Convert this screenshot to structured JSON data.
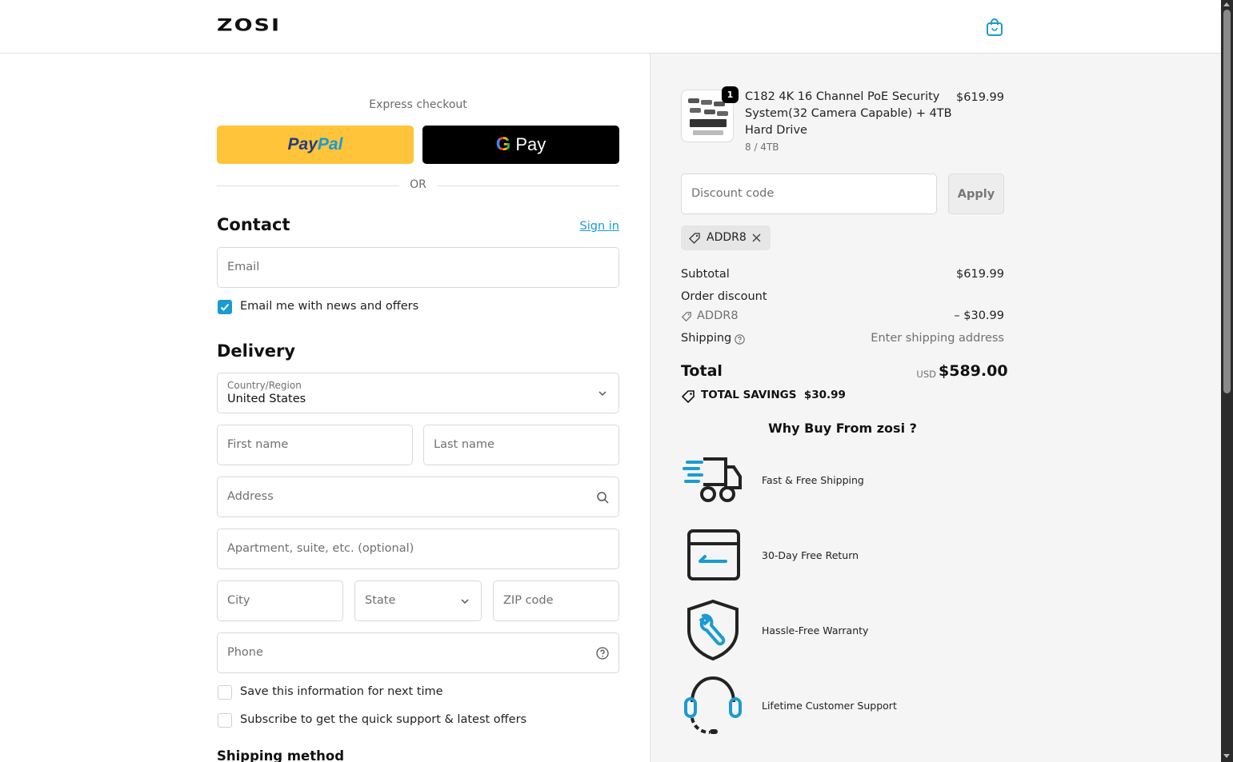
{
  "header": {
    "logo": "ZOSI",
    "cart_icon": "shopping-bag-icon"
  },
  "express": {
    "label": "Express checkout",
    "paypal_part1": "Pay",
    "paypal_part2": "Pal",
    "gpay_g": "G",
    "gpay_text": "Pay",
    "or_text": "OR"
  },
  "contact": {
    "title": "Contact",
    "signin_label": "Sign in",
    "email_placeholder": "Email",
    "news_checkbox_label": "Email me with news and offers",
    "news_checked": true
  },
  "delivery": {
    "title": "Delivery",
    "country_label": "Country/Region",
    "country_value": "United States",
    "first_name_placeholder": "First name",
    "last_name_placeholder": "Last name",
    "address_placeholder": "Address",
    "apartment_placeholder": "Apartment, suite, etc. (optional)",
    "city_placeholder": "City",
    "state_placeholder": "State",
    "zip_placeholder": "ZIP code",
    "phone_placeholder": "Phone",
    "save_info_label": "Save this information for next time",
    "subscribe_label": "Subscribe to get the quick support & latest offers",
    "shipping_method_title": "Shipping method"
  },
  "summary": {
    "product": {
      "quantity": "1",
      "name": "C182 4K 16 Channel PoE Security System(32 Camera Capable) + 4TB Hard Drive",
      "variant": "8 / 4TB",
      "price": "$619.99"
    },
    "discount_placeholder": "Discount code",
    "apply_label": "Apply",
    "applied_code": "ADDR8",
    "subtotal_label": "Subtotal",
    "subtotal_value": "$619.99",
    "order_discount_label": "Order discount",
    "discount_code": "ADDR8",
    "discount_value": "– $30.99",
    "shipping_label": "Shipping",
    "shipping_value": "Enter shipping address",
    "total_label": "Total",
    "total_currency": "USD",
    "total_value": "$589.00",
    "savings_label": "TOTAL SAVINGS",
    "savings_value": "$30.99"
  },
  "why_buy": {
    "title": "Why Buy From zosi ?",
    "items": [
      {
        "label": "Fast & Free Shipping",
        "icon": "delivery-truck-icon"
      },
      {
        "label": "30-Day Free Return",
        "icon": "return-box-icon"
      },
      {
        "label": "Hassle-Free Warranty",
        "icon": "shield-wrench-icon"
      },
      {
        "label": "Lifetime Customer Support",
        "icon": "headset-icon"
      }
    ]
  },
  "colors": {
    "accent": "#1a9bd1",
    "paypal_yellow": "#ffc439",
    "summary_bg": "#f5f5f5"
  }
}
